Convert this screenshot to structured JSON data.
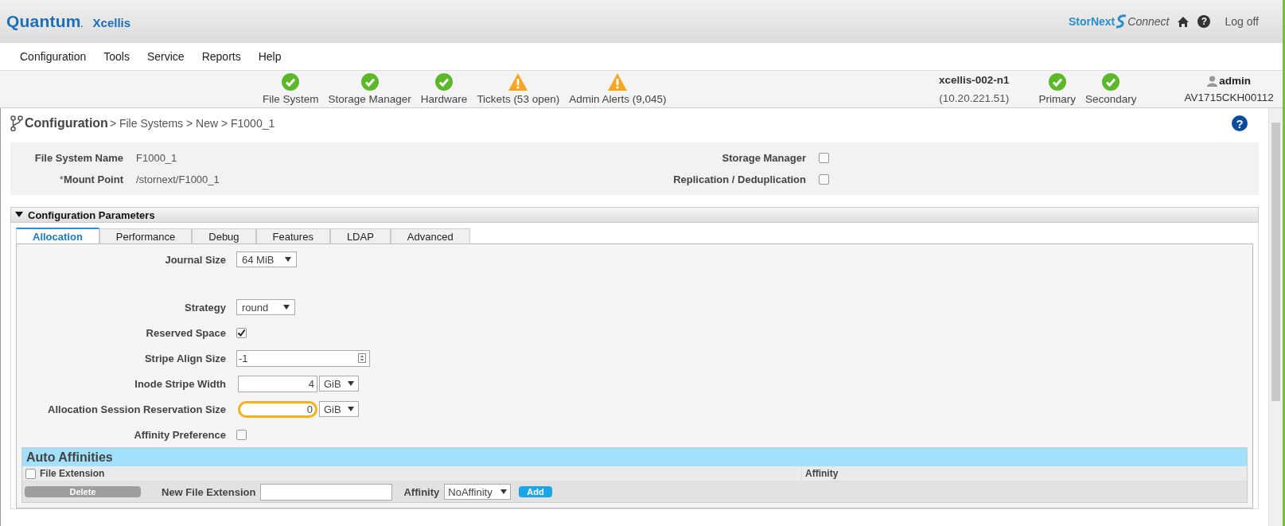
{
  "header": {
    "logo": "Quantum",
    "logo_mark": ".",
    "product": "Xcellis",
    "connect_brand": "StorNext",
    "connect_word": "Connect",
    "logoff": "Log off",
    "help_glyph": "?"
  },
  "menu": [
    "Configuration",
    "Tools",
    "Service",
    "Reports",
    "Help"
  ],
  "status": [
    {
      "label": "File System",
      "kind": "ok"
    },
    {
      "label": "Storage Manager",
      "kind": "ok"
    },
    {
      "label": "Hardware",
      "kind": "ok"
    },
    {
      "label": "Tickets (53 open)",
      "kind": "warning"
    },
    {
      "label": "Admin Alerts (9,045)",
      "kind": "warning"
    }
  ],
  "node": {
    "name": "xcellis-002-n1",
    "ip": "(10.20.221.51)"
  },
  "roles": [
    {
      "label": "Primary",
      "kind": "ok"
    },
    {
      "label": "Secondary",
      "kind": "ok"
    }
  ],
  "user": {
    "name": "admin",
    "serial": "AV1715CKH00112"
  },
  "breadcrumb": {
    "root": "Configuration",
    "path": "> File Systems > New > F1000_1",
    "help_glyph": "?"
  },
  "general": {
    "left": [
      {
        "label": "File System Name",
        "value": "F1000_1"
      },
      {
        "label": "Mount Point",
        "required_mark": "*",
        "value": "/stornext/F1000_1"
      }
    ],
    "right": [
      {
        "label": "Storage Manager",
        "checked": false
      },
      {
        "label": "Replication / Deduplication",
        "checked": false
      }
    ]
  },
  "section": {
    "title": "Configuration Parameters",
    "expanded": true
  },
  "tabs": [
    {
      "label": "Allocation",
      "selected": true
    },
    {
      "label": "Performance",
      "selected": false
    },
    {
      "label": "Debug",
      "selected": false
    },
    {
      "label": "Features",
      "selected": false
    },
    {
      "label": "LDAP",
      "selected": false
    },
    {
      "label": "Advanced",
      "selected": false
    }
  ],
  "fields": [
    {
      "kind": "select",
      "label": "Journal Size",
      "value": "64 MiB"
    },
    {
      "kind": "select",
      "label": "Strategy",
      "value": "round"
    },
    {
      "kind": "checkbox",
      "label": "Reserved Space",
      "checked": true
    },
    {
      "kind": "spinner",
      "label": "Stripe Align Size",
      "value": "-1"
    },
    {
      "kind": "number_unit",
      "label": "Inode Stripe Width",
      "value": "4",
      "unit": "GiB",
      "highlighted": false
    },
    {
      "kind": "number_unit",
      "label": "Allocation Session Reservation Size",
      "value": "0",
      "unit": "GiB",
      "highlighted": true
    },
    {
      "kind": "checkbox",
      "label": "Affinity Preference",
      "checked": false
    }
  ],
  "auto_affinities": {
    "title": "Auto Affinities",
    "columns": [
      "File Extension",
      "Affinity"
    ],
    "select_all_checked": false,
    "delete": "Delete",
    "new_label": "New File Extension",
    "affinity_label": "Affinity",
    "affinity_value": "NoAffinity",
    "add": "Add"
  }
}
